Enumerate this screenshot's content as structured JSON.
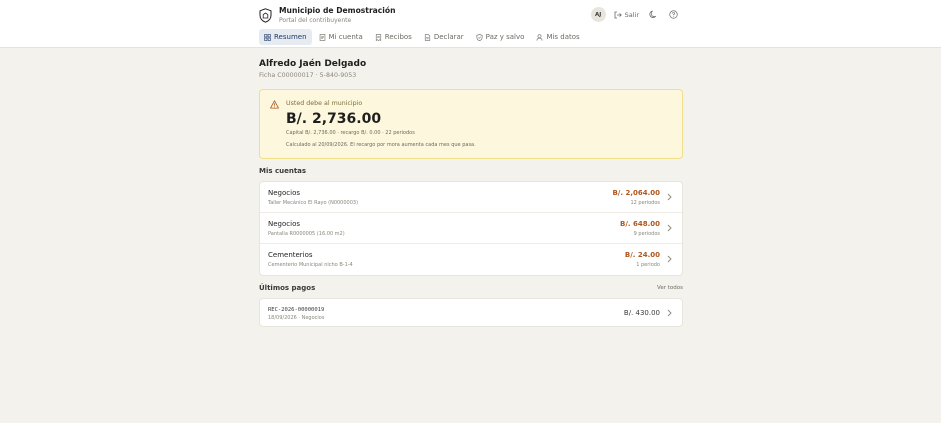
{
  "header": {
    "title": "Municipio de Demostración",
    "subtitle": "Portal del contribuyente",
    "avatar_initials": "AJ",
    "logout_label": "Salir"
  },
  "tabs": [
    {
      "label": "Resumen",
      "icon": "grid-icon",
      "active": true
    },
    {
      "label": "Mi cuenta",
      "icon": "document-icon",
      "active": false
    },
    {
      "label": "Recibos",
      "icon": "receipt-icon",
      "active": false
    },
    {
      "label": "Declarar",
      "icon": "file-icon",
      "active": false
    },
    {
      "label": "Paz y salvo",
      "icon": "shield-check-icon",
      "active": false
    },
    {
      "label": "Mis datos",
      "icon": "user-icon",
      "active": false
    }
  ],
  "person": {
    "name": "Alfredo Jaén Delgado",
    "ficha": "Ficha C00000017 · 5-840-9053"
  },
  "debt": {
    "label": "Usted debe al municipio",
    "amount": "B/. 2,736.00",
    "detail": "Capital B/. 2,736.00 · recargo B/. 0.00 · 22 periodos",
    "note": "Calculado al 20/09/2026. El recargo por mora aumenta cada mes que pasa."
  },
  "accounts": {
    "title": "Mis cuentas",
    "items": [
      {
        "title": "Negocios",
        "sub": "Taller Mecánico El Rayo (N0000003)",
        "amount": "B/. 2,064.00",
        "periods": "12 periodos"
      },
      {
        "title": "Negocios",
        "sub": "Pantalla R0000005 (16.00 m2)",
        "amount": "B/. 648.00",
        "periods": "9 periodos"
      },
      {
        "title": "Cementerios",
        "sub": "Cementerio Municipal nicho B-1-4",
        "amount": "B/. 24.00",
        "periods": "1 periodo"
      }
    ]
  },
  "payments": {
    "title": "Últimos pagos",
    "see_all": "Ver todos",
    "items": [
      {
        "ref": "REC-2026-00000019",
        "sub": "18/09/2026 · Negocios",
        "amount": "B/. 430.00"
      }
    ]
  },
  "colors": {
    "accent": "#1f3a66",
    "debt_amount": "#b0561c",
    "alert_bg": "#fdf7dd",
    "page_bg": "#f4f2ec"
  }
}
